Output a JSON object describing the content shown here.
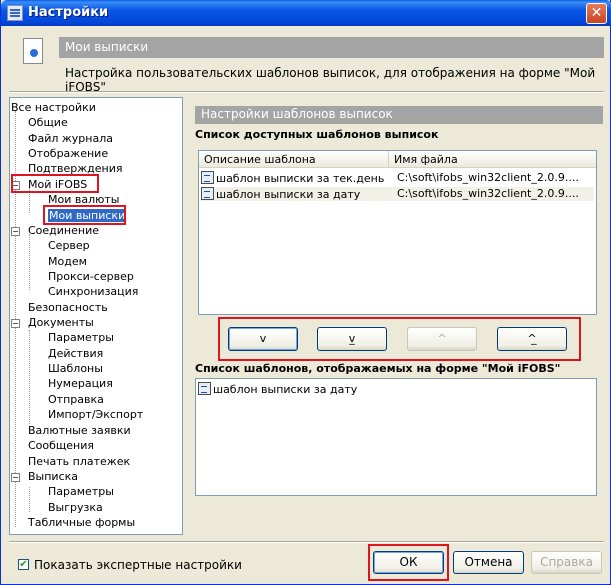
{
  "window": {
    "title": "Настройки"
  },
  "header": {
    "title": "Мои выписки",
    "description": "Настройка пользовательских шаблонов выписок, для отображения на форме \"Мой iFOBS\""
  },
  "tree": {
    "items": [
      {
        "label": "Все настройки"
      },
      {
        "label": "Общие"
      },
      {
        "label": "Файл журнала"
      },
      {
        "label": "Отображение"
      },
      {
        "label": "Подтверждения"
      },
      {
        "label": "Мой iFOBS",
        "expander": "−"
      },
      {
        "label": "Мои валюты"
      },
      {
        "label": "Мои выписки"
      },
      {
        "label": "Соединение",
        "expander": "−"
      },
      {
        "label": "Сервер"
      },
      {
        "label": "Модем"
      },
      {
        "label": "Прокси-сервер"
      },
      {
        "label": "Синхронизация"
      },
      {
        "label": "Безопасность"
      },
      {
        "label": "Документы",
        "expander": "−"
      },
      {
        "label": "Параметры"
      },
      {
        "label": "Действия"
      },
      {
        "label": "Шаблоны"
      },
      {
        "label": "Нумерация"
      },
      {
        "label": "Отправка"
      },
      {
        "label": "Импорт/Экспорт"
      },
      {
        "label": "Валютные заявки"
      },
      {
        "label": "Сообщения"
      },
      {
        "label": "Печать платежек"
      },
      {
        "label": "Выписка",
        "expander": "−"
      },
      {
        "label": "Параметры"
      },
      {
        "label": "Выгрузка"
      },
      {
        "label": "Табличные формы"
      }
    ]
  },
  "panel": {
    "title": "Настройки шаблонов выписок",
    "available_label": "Список доступных шаблонов выписок",
    "columns": [
      "Описание шаблона",
      "Имя файла"
    ],
    "rows": [
      {
        "description": "шаблон выписки за тек.день",
        "file": "C:\\soft\\ifobs_win32client_2.0.9...."
      },
      {
        "description": "шаблон выписки за дату",
        "file": "C:\\soft\\ifobs_win32client_2.0.9...."
      }
    ],
    "move_buttons": [
      "v",
      "v̲",
      "^",
      "^̲"
    ],
    "displayed_label": "Список шаблонов, отображаемых на форме \"Мой iFOBS\"",
    "displayed_items": [
      "шаблон выписки за дату"
    ]
  },
  "footer": {
    "expert_checkbox_label": "Показать экспертные настройки",
    "expert_checked": "✔",
    "ok_label": "ОК",
    "cancel_label": "Отмена",
    "help_label": "Справка"
  }
}
